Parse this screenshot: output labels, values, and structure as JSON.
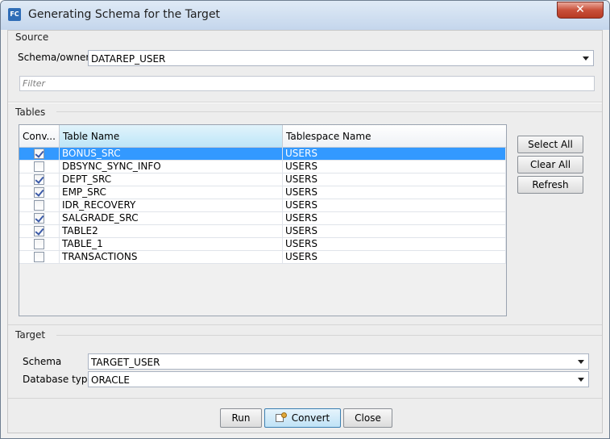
{
  "window": {
    "title": "Generating Schema for the Target",
    "app_icon": "FC",
    "close_symbol": "✕"
  },
  "source": {
    "section_label": "Source",
    "schema_label": "Schema/owner",
    "schema_value": "DATAREP_USER",
    "filter_placeholder": "Filter"
  },
  "tables": {
    "section_label": "Tables",
    "columns": [
      "Conv...",
      "Table Name",
      "Tablespace Name"
    ],
    "rows": [
      {
        "checked": true,
        "name": "BONUS_SRC",
        "tablespace": "USERS",
        "selected": true
      },
      {
        "checked": false,
        "name": "DBSYNC_SYNC_INFO",
        "tablespace": "USERS",
        "selected": false
      },
      {
        "checked": true,
        "name": "DEPT_SRC",
        "tablespace": "USERS",
        "selected": false
      },
      {
        "checked": true,
        "name": "EMP_SRC",
        "tablespace": "USERS",
        "selected": false
      },
      {
        "checked": false,
        "name": "IDR_RECOVERY",
        "tablespace": "USERS",
        "selected": false
      },
      {
        "checked": true,
        "name": "SALGRADE_SRC",
        "tablespace": "USERS",
        "selected": false
      },
      {
        "checked": true,
        "name": "TABLE2",
        "tablespace": "USERS",
        "selected": false
      },
      {
        "checked": false,
        "name": "TABLE_1",
        "tablespace": "USERS",
        "selected": false
      },
      {
        "checked": false,
        "name": "TRANSACTIONS",
        "tablespace": "USERS",
        "selected": false
      }
    ],
    "buttons": {
      "select_all": "Select All",
      "clear_all": "Clear All",
      "refresh": "Refresh"
    }
  },
  "target": {
    "section_label": "Target",
    "schema_label": "Schema",
    "schema_value": "TARGET_USER",
    "db_type_label": "Database type",
    "db_type_value": "ORACLE"
  },
  "footer": {
    "run": "Run",
    "convert": "Convert",
    "close": "Close"
  }
}
